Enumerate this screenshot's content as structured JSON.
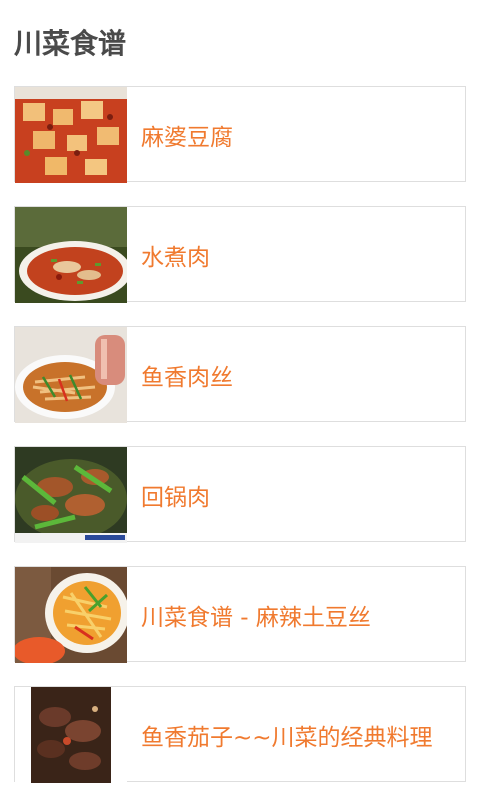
{
  "app": {
    "title": "川菜食谱"
  },
  "recipes": [
    {
      "title": "麻婆豆腐",
      "image": "mapo-tofu-photo"
    },
    {
      "title": "水煮肉",
      "image": "boiled-meat-photo"
    },
    {
      "title": "鱼香肉丝",
      "image": "fish-flavor-pork-photo"
    },
    {
      "title": "回锅肉",
      "image": "twice-cooked-pork-photo"
    },
    {
      "title": "川菜食谱 - 麻辣土豆丝",
      "image": "spicy-potato-photo"
    },
    {
      "title": "鱼香茄子~~川菜的经典料理",
      "image": "fish-flavor-eggplant-photo"
    }
  ]
}
